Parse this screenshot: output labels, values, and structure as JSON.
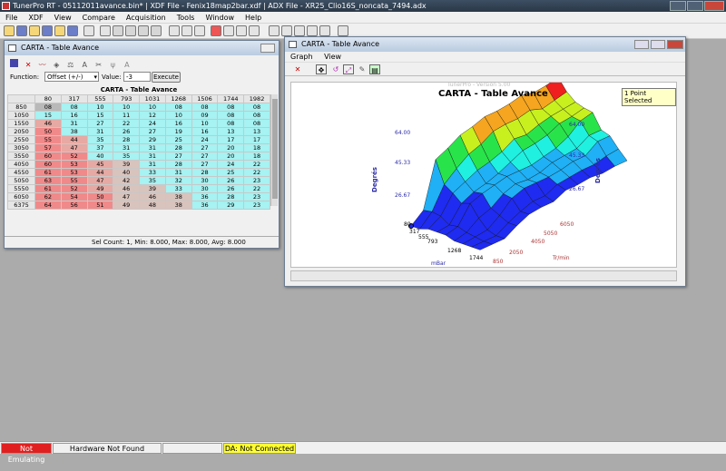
{
  "app": {
    "title": "TunerPro RT - 05112011avance.bin* | XDF File - Fenix18map2bar.xdf | ADX File - XR25_Clio16S_noncata_7494.adx",
    "menu": [
      "File",
      "XDF",
      "View",
      "Compare",
      "Acquisition",
      "Tools",
      "Window",
      "Help"
    ]
  },
  "table_window": {
    "title": "CARTA - Table Avance",
    "function_label": "Function:",
    "function_value": "Offset (+/-)",
    "value_label": "Value:",
    "value": "-3",
    "execute_label": "Execute",
    "grid_title": "CARTA - Table Avance",
    "columns": [
      "80",
      "317",
      "555",
      "793",
      "1031",
      "1268",
      "1506",
      "1744",
      "1982"
    ],
    "rows": [
      {
        "rpm": "850",
        "cells": [
          "08",
          "08",
          "10",
          "10",
          "10",
          "08",
          "08",
          "08",
          "08"
        ]
      },
      {
        "rpm": "1050",
        "cells": [
          "15",
          "16",
          "15",
          "11",
          "12",
          "10",
          "09",
          "08",
          "08"
        ]
      },
      {
        "rpm": "1550",
        "cells": [
          "46",
          "31",
          "27",
          "22",
          "24",
          "16",
          "10",
          "08",
          "08"
        ]
      },
      {
        "rpm": "2050",
        "cells": [
          "50",
          "38",
          "31",
          "26",
          "27",
          "19",
          "16",
          "13",
          "13"
        ]
      },
      {
        "rpm": "2550",
        "cells": [
          "55",
          "44",
          "35",
          "28",
          "29",
          "25",
          "24",
          "17",
          "17"
        ]
      },
      {
        "rpm": "3050",
        "cells": [
          "57",
          "47",
          "37",
          "31",
          "31",
          "28",
          "27",
          "20",
          "18"
        ]
      },
      {
        "rpm": "3550",
        "cells": [
          "60",
          "52",
          "40",
          "35",
          "31",
          "27",
          "27",
          "20",
          "18"
        ]
      },
      {
        "rpm": "4050",
        "cells": [
          "60",
          "53",
          "45",
          "39",
          "31",
          "28",
          "27",
          "24",
          "22"
        ]
      },
      {
        "rpm": "4550",
        "cells": [
          "61",
          "53",
          "44",
          "40",
          "33",
          "31",
          "28",
          "25",
          "22"
        ]
      },
      {
        "rpm": "5050",
        "cells": [
          "63",
          "55",
          "47",
          "42",
          "35",
          "32",
          "30",
          "26",
          "23"
        ]
      },
      {
        "rpm": "5550",
        "cells": [
          "61",
          "52",
          "49",
          "46",
          "39",
          "33",
          "30",
          "26",
          "22"
        ]
      },
      {
        "rpm": "6050",
        "cells": [
          "62",
          "54",
          "50",
          "47",
          "46",
          "38",
          "36",
          "28",
          "23"
        ]
      },
      {
        "rpm": "6375",
        "cells": [
          "64",
          "56",
          "51",
          "49",
          "48",
          "38",
          "36",
          "29",
          "23"
        ]
      }
    ],
    "status": "Sel Count: 1, Min: 8.000, Max: 8.000, Avg: 8.000"
  },
  "graph_window": {
    "title": "CARTA - Table Avance",
    "menu": [
      "Graph",
      "View"
    ],
    "watermark": "TunerPro - Version 5.00",
    "plot_title": "CARTA - Table Avance",
    "badge": "1 Point Selected",
    "left_axis_label": "Degrés",
    "right_axis_label": "Degrés",
    "left_ticks": [
      "64.00",
      "45.33",
      "26.67"
    ],
    "right_ticks": [
      "64.00",
      "45.33",
      "26.67"
    ],
    "x_axis_label": "mBar",
    "x_ticks": [
      "80",
      "317",
      "555",
      "793",
      "1268",
      "1744"
    ],
    "y_axis_label": "Tr/min",
    "y_ticks": [
      "850",
      "2050",
      "4050",
      "5050",
      "6050"
    ]
  },
  "status_bar": {
    "emulation": "Not Emulating",
    "hardware": "Hardware Not Found",
    "da": "DA: Not Connected"
  },
  "colors": {
    "not_emulating": "#e02020",
    "da_status": "#ffff33",
    "table_cyan": "#a7f2f2",
    "table_red": "#f08a8a",
    "surface_blue": "#1f2bf0"
  }
}
